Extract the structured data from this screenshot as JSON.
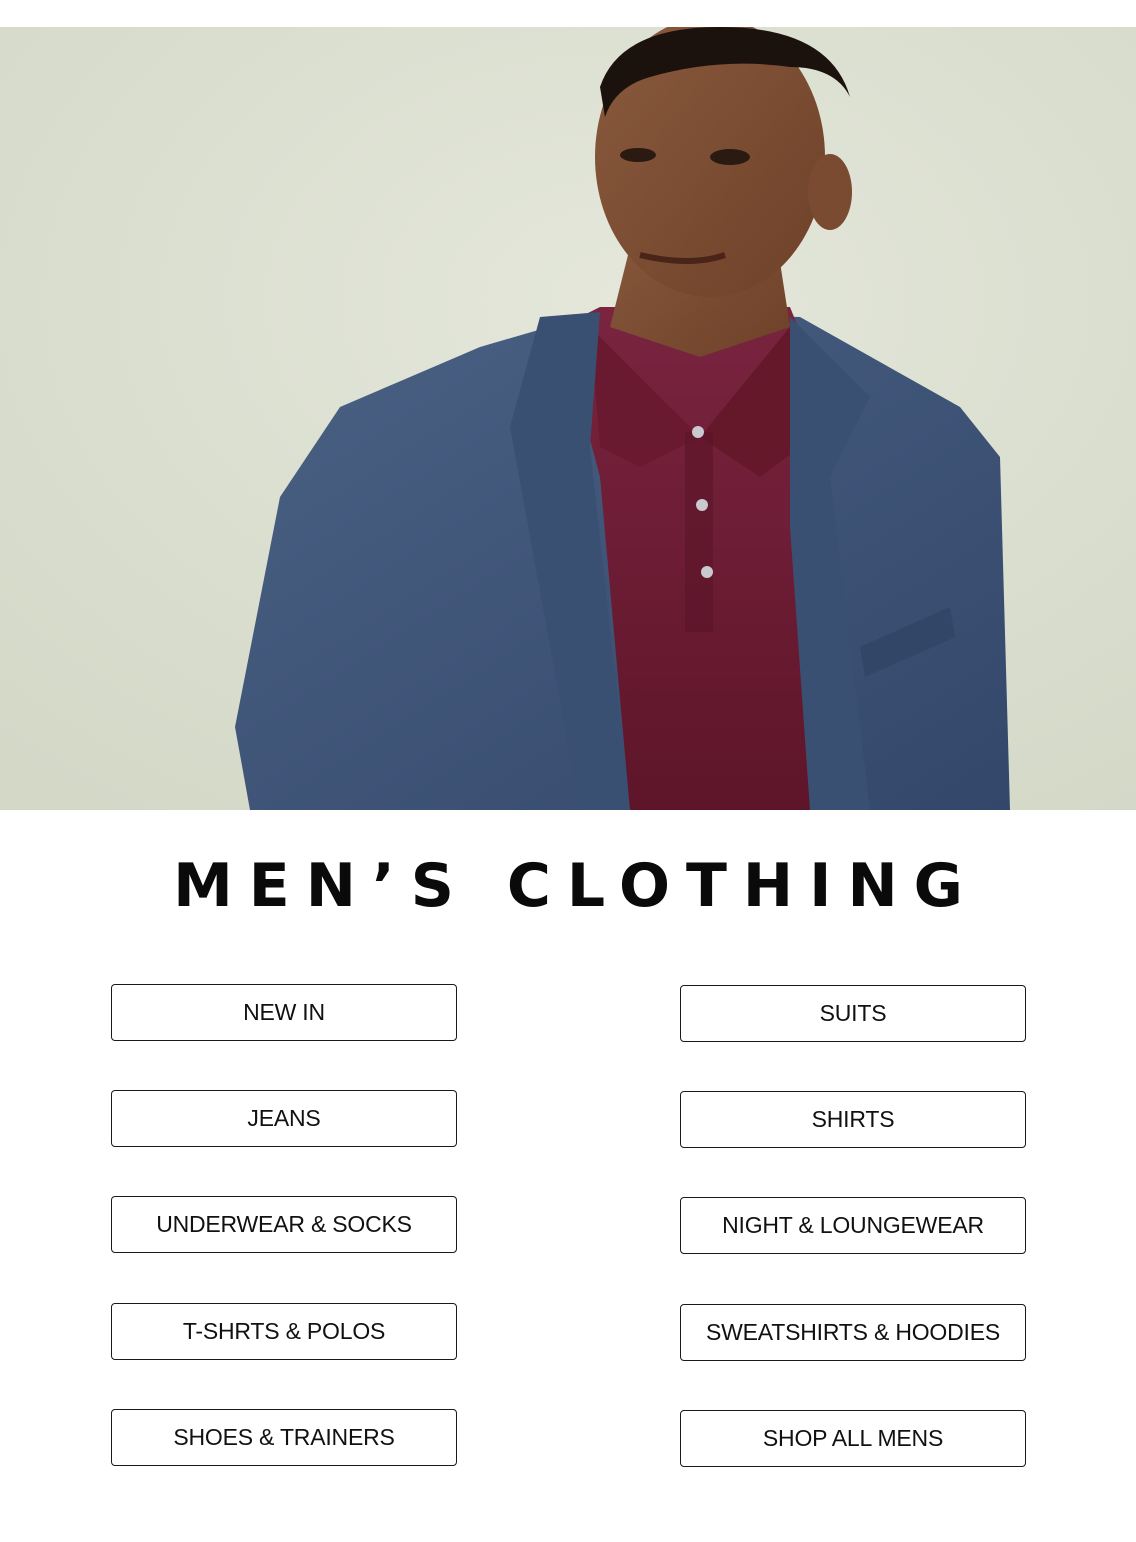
{
  "hero": {
    "image": "man-in-navy-blazer-and-burgundy-polo"
  },
  "heading": "MEN’S CLOTHING",
  "categories": {
    "left": [
      {
        "label": "NEW IN"
      },
      {
        "label": "JEANS"
      },
      {
        "label": "UNDERWEAR & SOCKS"
      },
      {
        "label": "T-SHRTS & POLOS"
      },
      {
        "label": "SHOES & TRAINERS"
      }
    ],
    "right": [
      {
        "label": "SUITS"
      },
      {
        "label": "SHIRTS"
      },
      {
        "label": "NIGHT & LOUNGEWEAR"
      },
      {
        "label": "SWEATSHIRTS & HOODIES"
      },
      {
        "label": "SHOP ALL MENS"
      }
    ]
  },
  "colors": {
    "background": "#ffffff",
    "text": "#111111",
    "button_border": "#1a1a1a",
    "hero_background": "#dde1d3",
    "blazer": "#3d5474",
    "polo": "#6e1d34"
  }
}
